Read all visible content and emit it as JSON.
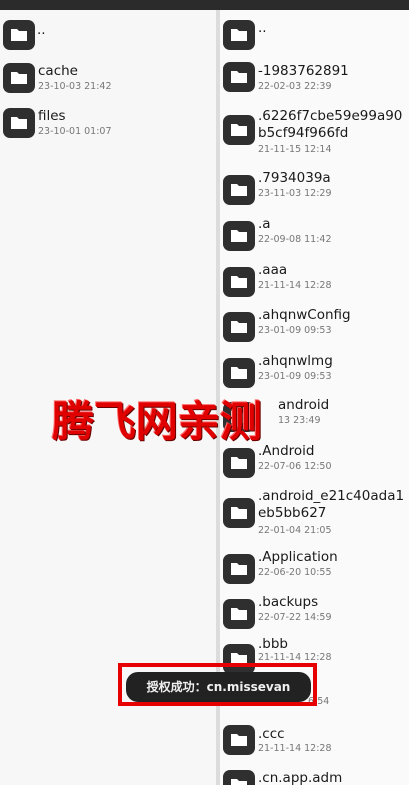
{
  "left_pane": {
    "items": [
      {
        "name": "..",
        "date": ""
      },
      {
        "name": "cache",
        "date": "23-10-03 21:42"
      },
      {
        "name": "files",
        "date": "23-10-01 01:07"
      }
    ]
  },
  "right_pane": {
    "items": [
      {
        "name": "..",
        "date": ""
      },
      {
        "name": "-1983762891",
        "date": "22-02-03 22:39"
      },
      {
        "name": ".6226f7cbe59e99a90b5cf94f966fd",
        "date": "21-11-15 12:14"
      },
      {
        "name": ".7934039a",
        "date": "23-11-03 12:29"
      },
      {
        "name": ".a",
        "date": "22-09-08 11:42"
      },
      {
        "name": ".aaa",
        "date": "21-11-14 12:28"
      },
      {
        "name": ".ahqnwConfig",
        "date": "23-01-09 09:53"
      },
      {
        "name": ".ahqnwlmg",
        "date": "23-01-09 09:53"
      },
      {
        "name": "android",
        "date": "13 23:49"
      },
      {
        "name": ".Android",
        "date": "22-07-06 12:50"
      },
      {
        "name": ".android_e21c40ada1eb5bb627",
        "date": "22-01-04 21:05"
      },
      {
        "name": ".Application",
        "date": "22-06-20 10:55"
      },
      {
        "name": ".backups",
        "date": "22-07-22 14:59"
      },
      {
        "name": ".bbb",
        "date": "21-11-14 12:28"
      },
      {
        "name": "",
        "date": "6:54"
      },
      {
        "name": ".ccc",
        "date": "21-11-14 12:28"
      },
      {
        "name": ".cn.app.adm",
        "date": ""
      }
    ]
  },
  "watermark": {
    "text": "腾飞网亲测"
  },
  "toast": {
    "text": "授权成功：cn.missevan"
  },
  "colors": {
    "folder": "#2f2f2f",
    "watermark": "#e00000",
    "highlight": "#e60000",
    "toast_bg": "#222222"
  }
}
